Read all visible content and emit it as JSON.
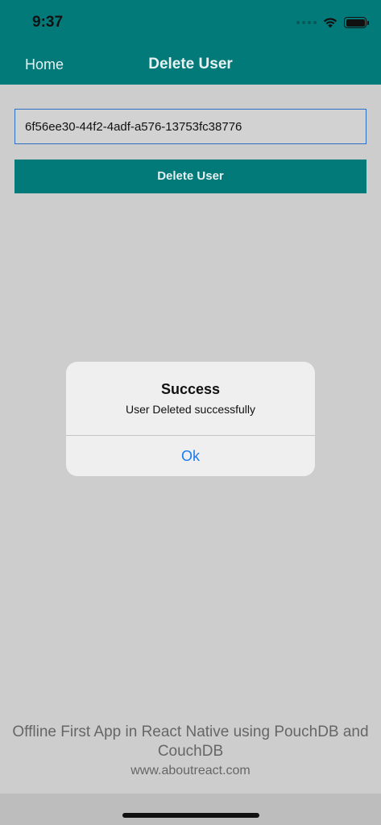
{
  "status_bar": {
    "time": "9:37",
    "icons": [
      "signal-icon",
      "wifi-icon",
      "battery-icon"
    ]
  },
  "nav": {
    "back_label": "Home",
    "title": "Delete User"
  },
  "form": {
    "user_id_value": "6f56ee30-44f2-4adf-a576-13753fc38776",
    "delete_button_label": "Delete User"
  },
  "alert": {
    "title": "Success",
    "message": "User Deleted successfully",
    "ok_label": "Ok"
  },
  "footer": {
    "title": "Offline First App in React Native using PouchDB and CouchDB",
    "url": "www.aboutreact.com"
  },
  "colors": {
    "accent": "#037a7a",
    "background": "#cdcdcd",
    "alert_button": "#1a7bf0"
  }
}
